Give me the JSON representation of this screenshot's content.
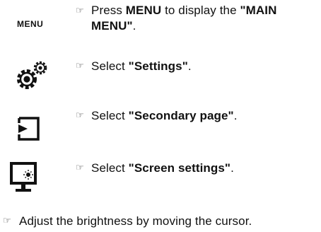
{
  "steps": [
    {
      "icon": "menu-button-label",
      "icon_text": "MENU",
      "before": "Press ",
      "bold1": "MENU",
      "middle": " to display the ",
      "bold2": "\"MAIN MENU\"",
      "after": "."
    },
    {
      "icon": "settings-gear-icon",
      "before": "Select ",
      "bold1": "\"Settings\"",
      "after": "."
    },
    {
      "icon": "secondary-page-icon",
      "before": "Select ",
      "bold1": "\"Secondary page\"",
      "after": "."
    },
    {
      "icon": "screen-settings-icon",
      "before": "Select ",
      "bold1": "\"Screen settings\"",
      "after": "."
    }
  ],
  "final_note": "Adjust the brightness by moving the cursor.",
  "pointer_glyph": "☞"
}
